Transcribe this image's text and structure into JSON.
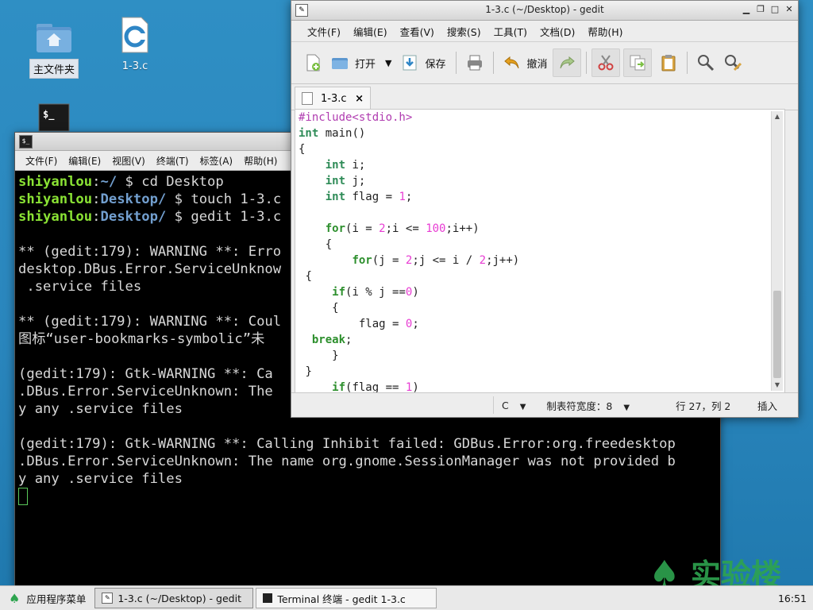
{
  "desktop": {
    "icons": [
      {
        "label": "主文件夹"
      },
      {
        "label": "1-3.c"
      },
      {
        "label": ""
      }
    ]
  },
  "terminal": {
    "menu": [
      "文件(F)",
      "编辑(E)",
      "视图(V)",
      "终端(T)",
      "标签(A)",
      "帮助(H)"
    ],
    "lines": {
      "l1_user": "shiyanlou",
      "l1_sep": ":",
      "l1_path": "~/",
      "l1_cmd": " $ cd Desktop",
      "l2_user": "shiyanlou",
      "l2_sep": ":",
      "l2_path": "Desktop/",
      "l2_cmd": " $ touch 1-3.c",
      "l3_user": "shiyanlou",
      "l3_sep": ":",
      "l3_path": "Desktop/",
      "l3_cmd": " $ gedit 1-3.c",
      "l4": "** (gedit:179): WARNING **: Erro",
      "l5": "desktop.DBus.Error.ServiceUnknow",
      "l6": " .service files",
      "l7": "** (gedit:179): WARNING **: Coul",
      "l8": "图标“user-bookmarks-symbolic”未",
      "l9": "(gedit:179): Gtk-WARNING **: Ca",
      "l10": ".DBus.Error.ServiceUnknown: The",
      "l11": "y any .service files",
      "l12": "(gedit:179): Gtk-WARNING **: Calling Inhibit failed: GDBus.Error:org.freedesktop",
      "l13": ".DBus.Error.ServiceUnknown: The name org.gnome.SessionManager was not provided b",
      "l14": "y any .service files"
    }
  },
  "gedit": {
    "title": "1-3.c (~/Desktop) - gedit",
    "menu": [
      "文件(F)",
      "编辑(E)",
      "查看(V)",
      "搜索(S)",
      "工具(T)",
      "文档(D)",
      "帮助(H)"
    ],
    "toolbar": {
      "open": "打开",
      "save": "保存",
      "undo": "撤消"
    },
    "tab": {
      "label": "1-3.c",
      "close": "×"
    },
    "code": {
      "c1": "#include<stdio.h>",
      "c2_kw": "int",
      "c2_rest": " main()",
      "c3": "{",
      "c4_kw": "int",
      "c4_rest": " i;",
      "c5_kw": "int",
      "c5_rest": " j;",
      "c6_kw": "int",
      "c6_rest": " flag = ",
      "c6_num": "1",
      "c6_end": ";",
      "c8_kw": "for",
      "c8_a": "(i = ",
      "c8_n1": "2",
      "c8_b": ";i <= ",
      "c8_n2": "100",
      "c8_c": ";i++)",
      "c9": "{",
      "c10_kw": "for",
      "c10_a": "(j = ",
      "c10_n1": "2",
      "c10_b": ";j <= i / ",
      "c10_n2": "2",
      "c10_c": ";j++)",
      "c11": "{",
      "c12_kw": "if",
      "c12_a": "(i % j ==",
      "c12_n": "0",
      "c12_b": ")",
      "c13": "{",
      "c14_a": "flag = ",
      "c14_n": "0",
      "c14_b": ";",
      "c15_kw": "break",
      "c15_b": ";",
      "c16": "}",
      "c17": "}",
      "c18_kw": "if",
      "c18_a": "(flag == ",
      "c18_n": "1",
      "c18_b": ")"
    },
    "status": {
      "lang": "C",
      "tab_width": "制表符宽度：8",
      "position": "行 27，列 2",
      "mode": "插入"
    }
  },
  "taskbar": {
    "menu": "应用程序菜单",
    "tasks": [
      "1-3.c (~/Desktop) - gedit",
      "Terminal 终端 - gedit 1-3.c"
    ],
    "clock": "16:51"
  },
  "watermark": {
    "text": "实验楼"
  },
  "colors": {
    "accent_green": "#8ae234",
    "path_blue": "#729fcf",
    "keyword": "#2d8f2d",
    "number": "#e83cd3"
  }
}
